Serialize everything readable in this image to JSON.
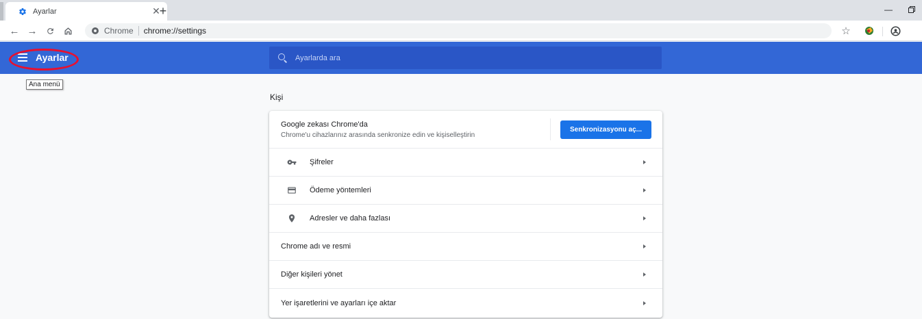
{
  "tabs": [
    {
      "title": "Ayarlar",
      "icon": "gear-icon"
    }
  ],
  "toolbar": {
    "site_chip": "Chrome",
    "url": "chrome://settings"
  },
  "header": {
    "title": "Ayarlar",
    "search_placeholder": "Ayarlarda ara"
  },
  "tooltip": "Ana menü",
  "colors": {
    "header_bg": "#3367d6",
    "accent": "#1a73e8",
    "highlight_circle": "#e8102e"
  },
  "section": {
    "title": "Kişi",
    "sync": {
      "title": "Google zekası Chrome'da",
      "subtitle": "Chrome'u cihazlarınız arasında senkronize edin ve kişiselleştirin",
      "button": "Senkronizasyonu aç..."
    },
    "rows": [
      {
        "label": "Şifreler",
        "icon": "key-icon"
      },
      {
        "label": "Ödeme yöntemleri",
        "icon": "credit-card-icon"
      },
      {
        "label": "Adresler ve daha fazlası",
        "icon": "location-pin-icon"
      },
      {
        "label": "Chrome adı ve resmi"
      },
      {
        "label": "Diğer kişileri yönet"
      },
      {
        "label": "Yer işaretlerini ve ayarları içe aktar"
      }
    ]
  }
}
